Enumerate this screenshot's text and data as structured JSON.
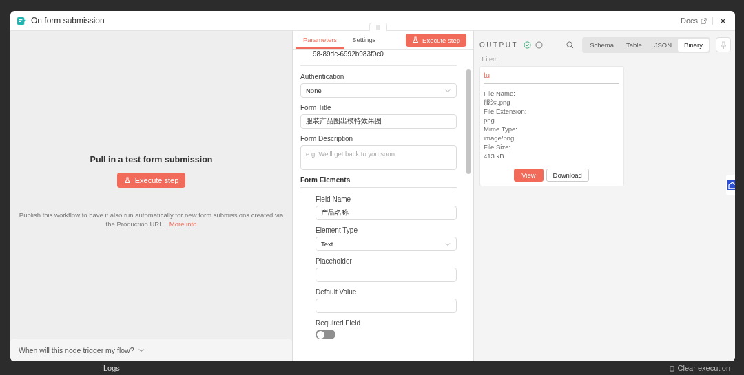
{
  "background": {
    "logs_label": "Logs",
    "clear_button": "Clear execution"
  },
  "window": {
    "title": "On form submission",
    "docs_link": "Docs"
  },
  "test_panel": {
    "heading": "Pull in a test form submission",
    "button": "Execute step",
    "note": "Publish this workflow to have it also run automatically for new form submissions created via the Production URL.",
    "note_link": "More info",
    "footer_question": "When will this node trigger my flow?",
    "footer_expanded": false
  },
  "parameters_panel": {
    "tabs": [
      {
        "label": "Parameters",
        "selected": true
      },
      {
        "label": "Settings",
        "selected": false
      }
    ],
    "execute_button": "Execute step",
    "cut_text": "98-89dc-6992b983f0c0",
    "fields": [
      {
        "kind": "select",
        "label": "Authentication",
        "value": "None"
      },
      {
        "kind": "input",
        "label": "Form Title",
        "value": "服装产品图出模特效果图"
      },
      {
        "kind": "textarea",
        "label": "Form Description",
        "placeholder": "e.g. We'll get back to you soon"
      }
    ],
    "section": "Form Elements",
    "element_fields": [
      {
        "kind": "input",
        "label": "Field Name",
        "value": "产品名称"
      },
      {
        "kind": "select",
        "label": "Element Type",
        "value": "Text"
      },
      {
        "kind": "input",
        "label": "Placeholder"
      },
      {
        "kind": "input",
        "label": "Default Value"
      },
      {
        "kind": "toggle",
        "label": "Required Field",
        "on": false
      }
    ]
  },
  "output_panel": {
    "title": "OUTPUT",
    "view_tabs": [
      {
        "label": "Schema",
        "selected": false
      },
      {
        "label": "Table",
        "selected": false
      },
      {
        "label": "JSON",
        "selected": false
      },
      {
        "label": "Binary",
        "selected": true
      }
    ],
    "item_count": "1 item",
    "binary_item": {
      "name": "tu",
      "properties": [
        {
          "label": "File Name:",
          "value": "服装.png"
        },
        {
          "label": "File Extension:",
          "value": "png"
        },
        {
          "label": "Mime Type:",
          "value": "image/png"
        },
        {
          "label": "File Size:",
          "value": "413 kB"
        }
      ],
      "view_button": "View",
      "download_button": "Download"
    }
  }
}
